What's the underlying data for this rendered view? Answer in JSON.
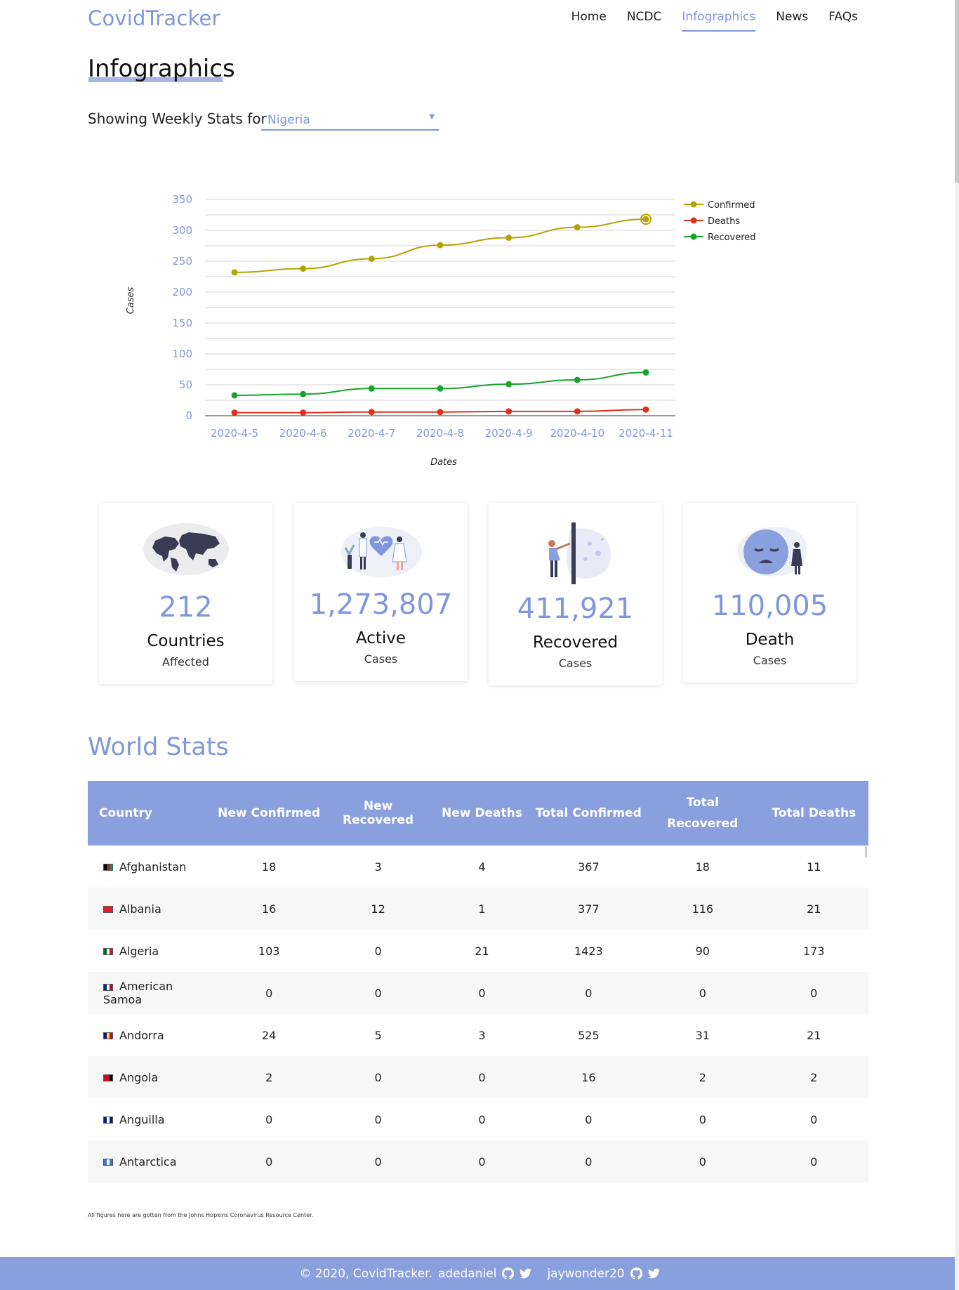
{
  "header": {
    "logo": "CovidTracker",
    "nav": [
      {
        "label": "Home"
      },
      {
        "label": "NCDC"
      },
      {
        "label": "Infographics"
      },
      {
        "label": "News"
      },
      {
        "label": "FAQs"
      }
    ],
    "active_nav": "Infographics"
  },
  "page_title": "Infographics",
  "weekly": {
    "label": "Showing Weekly Stats for",
    "selected_country": "Nigeria"
  },
  "chart_data": {
    "type": "line",
    "title": "",
    "xlabel": "Dates",
    "ylabel": "Cases",
    "x": [
      "2020-4-5",
      "2020-4-6",
      "2020-4-7",
      "2020-4-8",
      "2020-4-9",
      "2020-4-10",
      "2020-4-11"
    ],
    "ylim": [
      0,
      350
    ],
    "yticks": [
      0,
      50,
      100,
      150,
      200,
      250,
      300,
      350
    ],
    "grid": true,
    "legend": "top-right",
    "series": [
      {
        "name": "Confirmed",
        "color": "#b5a400",
        "values": [
          232,
          238,
          254,
          276,
          288,
          305,
          318
        ]
      },
      {
        "name": "Deaths",
        "color": "#e0301e",
        "values": [
          5,
          5,
          6,
          6,
          7,
          7,
          10
        ]
      },
      {
        "name": "Recovered",
        "color": "#18a32c",
        "values": [
          33,
          35,
          44,
          44,
          51,
          58,
          70
        ]
      }
    ]
  },
  "cards": [
    {
      "number": "212",
      "label": "Countries",
      "sublabel": "Affected",
      "icon": "world-map-icon"
    },
    {
      "number": "1,273,807",
      "label": "Active",
      "sublabel": "Cases",
      "icon": "doctors-heart-icon"
    },
    {
      "number": "411,921",
      "label": "Recovered",
      "sublabel": "Cases",
      "icon": "person-recovering-icon"
    },
    {
      "number": "110,005",
      "label": "Death",
      "sublabel": "Cases",
      "icon": "sad-face-icon"
    }
  ],
  "world_stats": {
    "title": "World Stats",
    "columns": [
      "Country",
      "New Confirmed",
      "New Recovered",
      "New Deaths",
      "Total Confirmed",
      "Total Recovered",
      "Total Deaths"
    ],
    "rows": [
      {
        "country": "Afghanistan",
        "flag": [
          "#000000",
          "#c8102e",
          "#009a44"
        ],
        "values": [
          "18",
          "3",
          "4",
          "367",
          "18",
          "11"
        ]
      },
      {
        "country": "Albania",
        "flag": [
          "#e41e20",
          "#e41e20",
          "#e41e20"
        ],
        "values": [
          "16",
          "12",
          "1",
          "377",
          "116",
          "21"
        ]
      },
      {
        "country": "Algeria",
        "flag": [
          "#006633",
          "#ffffff",
          "#d21034"
        ],
        "values": [
          "103",
          "0",
          "21",
          "1423",
          "90",
          "173"
        ]
      },
      {
        "country": "American Samoa",
        "flag": [
          "#002b7f",
          "#ffffff",
          "#bf0a30"
        ],
        "values": [
          "0",
          "0",
          "0",
          "0",
          "0",
          "0"
        ]
      },
      {
        "country": "Andorra",
        "flag": [
          "#10069f",
          "#fedd00",
          "#d50032"
        ],
        "values": [
          "24",
          "5",
          "3",
          "525",
          "31",
          "21"
        ]
      },
      {
        "country": "Angola",
        "flag": [
          "#cc092f",
          "#cc092f",
          "#000000"
        ],
        "values": [
          "2",
          "0",
          "0",
          "16",
          "2",
          "2"
        ]
      },
      {
        "country": "Anguilla",
        "flag": [
          "#00247d",
          "#ffffff",
          "#00247d"
        ],
        "values": [
          "0",
          "0",
          "0",
          "0",
          "0",
          "0"
        ]
      },
      {
        "country": "Antarctica",
        "flag": [
          "#3a7dce",
          "#ffffff",
          "#3a7dce"
        ],
        "values": [
          "0",
          "0",
          "0",
          "0",
          "0",
          "0"
        ]
      }
    ]
  },
  "source_note": "All figures here are gotten from the Johns Hopkins Coronavirus Resource Center.",
  "footer": {
    "copyright": "© 2020, CovidTracker.",
    "author1": "adedaniel",
    "author2": "jaywonder20"
  }
}
